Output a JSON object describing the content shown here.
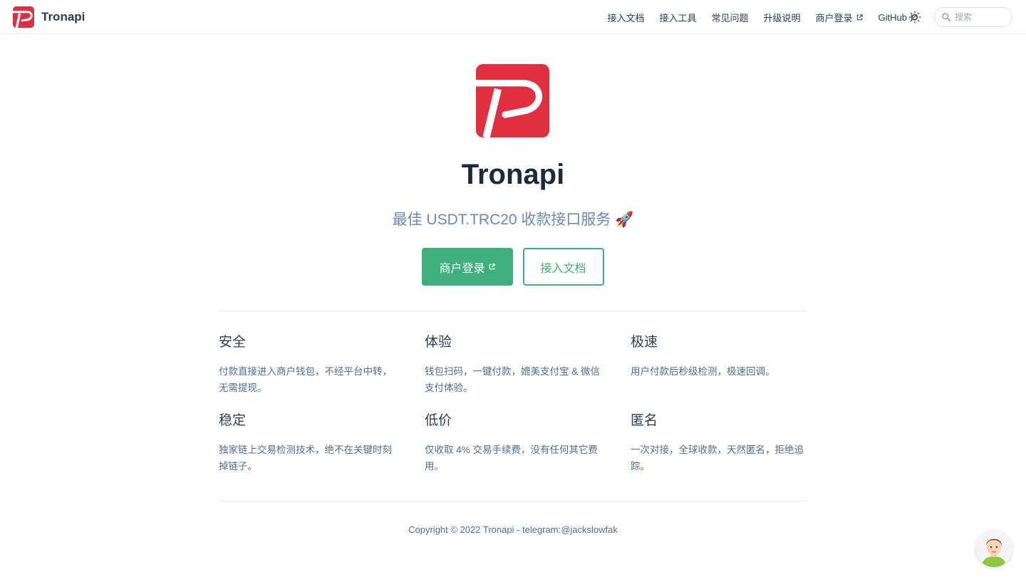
{
  "brand": {
    "name": "Tronapi",
    "color": "#e03040"
  },
  "nav": {
    "items": [
      {
        "label": "接入文档",
        "external": false
      },
      {
        "label": "接入工具",
        "external": false
      },
      {
        "label": "常见问题",
        "external": false
      },
      {
        "label": "升级说明",
        "external": false
      },
      {
        "label": "商户登录",
        "external": true
      },
      {
        "label": "GitHub",
        "external": true
      }
    ],
    "theme_icon": "sun-icon",
    "search_placeholder": "搜索"
  },
  "hero": {
    "title": "Tronapi",
    "description": "最佳 USDT.TRC20 收款接口服务 🚀",
    "primary_action": "商户登录",
    "secondary_action": "接入文档",
    "accent_color": "#3eaf7c"
  },
  "features": [
    {
      "title": "安全",
      "details": "付款直接进入商户钱包，不经平台中转，无需提现。"
    },
    {
      "title": "体验",
      "details": "钱包扫码，一键付款，媲美支付宝 & 微信支付体验。"
    },
    {
      "title": "极速",
      "details": "用户付款后秒级检测，极速回调。"
    },
    {
      "title": "稳定",
      "details": "独家链上交易检测技术，绝不在关键时刻掉链子。"
    },
    {
      "title": "低价",
      "details": "仅收取 4% 交易手续费，没有任何其它费用。"
    },
    {
      "title": "匿名",
      "details": "一次对接，全球收款，天然匿名，拒绝追踪。"
    }
  ],
  "footer": {
    "copyright": "Copyright © 2022 Tronapi - telegram:@jackslowfak"
  }
}
